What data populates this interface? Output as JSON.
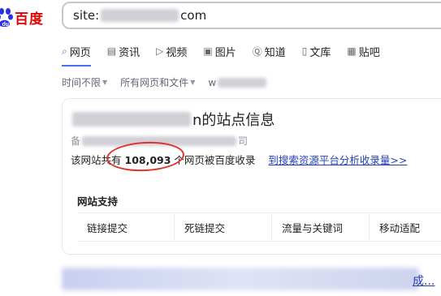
{
  "brand": {
    "logo_text": "百度",
    "accent": "#e10602",
    "logo_blue": "#2932e1"
  },
  "search": {
    "query_prefix": "site:",
    "query_suffix": "com"
  },
  "tabs": [
    {
      "label": "网页",
      "icon": "search-icon",
      "active": true
    },
    {
      "label": "资讯",
      "icon": "news-icon",
      "active": false
    },
    {
      "label": "视频",
      "icon": "video-icon",
      "active": false
    },
    {
      "label": "图片",
      "icon": "image-icon",
      "active": false
    },
    {
      "label": "知道",
      "icon": "question-icon",
      "active": false
    },
    {
      "label": "文库",
      "icon": "doc-icon",
      "active": false
    },
    {
      "label": "贴吧",
      "icon": "tieba-icon",
      "active": false
    }
  ],
  "filters": {
    "time": "时间不限",
    "type": "所有网页和文件",
    "site_prefix": "w"
  },
  "result_card": {
    "title_suffix": "n的站点信息",
    "subtitle_prefix": "备",
    "subtitle_suffix": "司",
    "stat_prefix": "该网站共有",
    "stat_number": "108,093",
    "stat_suffix": "个网页被百度收录",
    "link_text": "到搜索资源平台分析收录量>>",
    "support_title": "网站支持",
    "support_items": [
      "链接提交",
      "死链提交",
      "流量与关键词",
      "移动适配"
    ]
  },
  "bottom": {
    "tail_text": "成..."
  },
  "colors": {
    "link": "#2440b3",
    "tab_active": "#4e6ef2",
    "annotation": "#e0312d"
  }
}
